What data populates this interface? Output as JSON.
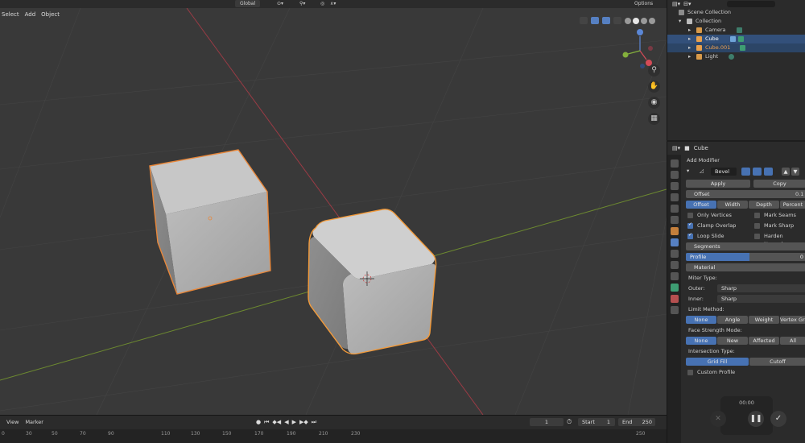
{
  "topbar": {
    "orientation": "Global",
    "options": "Options"
  },
  "menu": {
    "select": "Select",
    "add": "Add",
    "object": "Object"
  },
  "outliner": {
    "scene_collection": "Scene Collection",
    "collection": "Collection",
    "items": [
      {
        "label": "Camera",
        "selected": false,
        "color": "#d89a4a"
      },
      {
        "label": "Cube",
        "selected": true,
        "color": "#e8a04c"
      },
      {
        "label": "Cube.001",
        "selected": true,
        "color": "#e8a04c"
      },
      {
        "label": "Light",
        "selected": false,
        "color": "#d89a4a"
      }
    ]
  },
  "properties": {
    "object_name": "Cube",
    "add_modifier": "Add Modifier",
    "modifier_name": "Bevel",
    "apply": "Apply",
    "copy": "Copy",
    "offset_label": "Offset",
    "offset_value": "0.1",
    "width_tabs": [
      "Offset",
      "Width",
      "Depth",
      "Percent"
    ],
    "only_vertices": "Only Vertices",
    "mark_seams": "Mark Seams",
    "clamp_overlap": "Clamp Overlap",
    "mark_sharp": "Mark Sharp",
    "loop_slide": "Loop Slide",
    "harden_normals": "Harden Normals",
    "segments": "Segments",
    "profile_label": "Profile",
    "profile_value": "0",
    "material": "Material",
    "miter_type": "Miter Type:",
    "outer_label": "Outer:",
    "outer_value": "Sharp",
    "inner_label": "Inner:",
    "inner_value": "Sharp",
    "limit_method": "Limit Method:",
    "limit_tabs": [
      "None",
      "Angle",
      "Weight",
      "Vertex Group"
    ],
    "face_strength": "Face Strength Mode:",
    "face_tabs": [
      "None",
      "New",
      "Affected",
      "All"
    ],
    "intersection_type": "Intersection Type:",
    "intersection_tabs": [
      "Grid Fill",
      "Cutoff"
    ],
    "custom_profile": "Custom Profile"
  },
  "recorder": {
    "time": "00:00"
  },
  "timeline": {
    "view": "View",
    "marker": "Marker",
    "current_frame": "1",
    "start_label": "Start",
    "start_value": "1",
    "end_label": "End",
    "end_value": "250",
    "ruler_ticks": [
      "0",
      "30",
      "50",
      "70",
      "90",
      "110",
      "130",
      "150",
      "170",
      "190",
      "210",
      "230",
      "250"
    ]
  }
}
